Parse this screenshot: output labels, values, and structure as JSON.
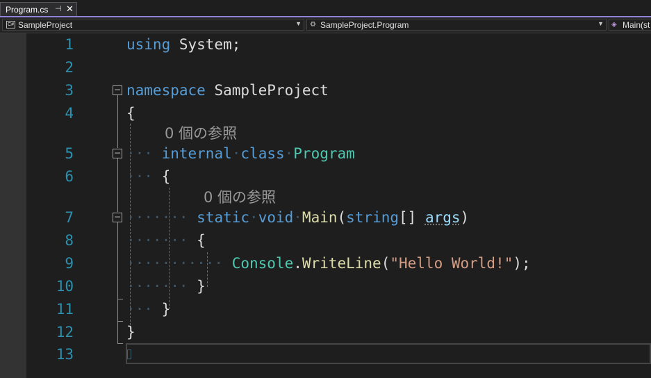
{
  "tab": {
    "title": "Program.cs",
    "pin_glyph": "⊣",
    "close_glyph": "✕"
  },
  "navbar": {
    "project": "SampleProject",
    "class": "SampleProject.Program",
    "member": "Main(st"
  },
  "line_numbers": [
    "1",
    "2",
    "3",
    "4",
    "5",
    "6",
    "7",
    "8",
    "9",
    "10",
    "11",
    "12",
    "13"
  ],
  "codelens": [
    "0 個の参照",
    "0 個の参照"
  ],
  "code": {
    "l1_kw": "using",
    "l1_rest": " System;",
    "l3_kw": "namespace",
    "l3_rest": " SampleProject",
    "l4": "{",
    "l5_kw1": "internal",
    "l5_kw2": "class",
    "l5_type": "Program",
    "l6": "{",
    "l7_kw1": "static",
    "l7_kw2": "void",
    "l7_fn": "Main",
    "l7_p1": "(",
    "l7_kw3": "string",
    "l7_p2": "[] ",
    "l7_arg": "args",
    "l7_p3": ")",
    "l8": "{",
    "l9_type": "Console",
    "l9_dot": ".",
    "l9_fn": "WriteLine",
    "l9_p1": "(",
    "l9_str": "\"Hello World!\"",
    "l9_p2": ");",
    "l10": "}",
    "l11": "}",
    "l12": "}"
  },
  "colors": {
    "keyword": "#569cd6",
    "type": "#4ec9b0",
    "method": "#dcdcaa",
    "string": "#d69d85",
    "line_number": "#2b91af",
    "tab_accent": "#8f82d8"
  }
}
